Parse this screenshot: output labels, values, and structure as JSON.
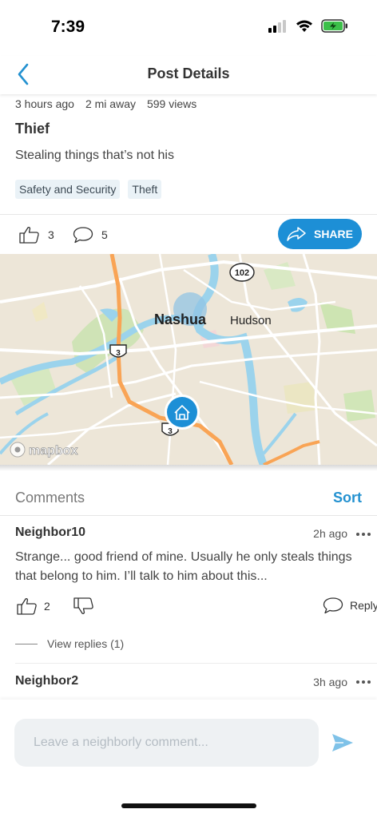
{
  "status_bar": {
    "time": "7:39",
    "icons": [
      "signal-icon",
      "wifi-icon",
      "battery-charging-icon"
    ],
    "battery_color": "#3cc04a"
  },
  "nav": {
    "title": "Post Details",
    "back_icon": "chevron-left-icon",
    "accent_color": "#2391d0"
  },
  "post": {
    "posted_ago": "3 hours ago",
    "distance": "2 mi away",
    "views": "599 views",
    "title": "Thief",
    "body": "Stealing things that’s not his",
    "tags": [
      "Safety and Security",
      "Theft"
    ],
    "likes": "3",
    "comments_count": "5",
    "share_label": "SHARE"
  },
  "map": {
    "city_primary": "Nashua",
    "city_secondary": "Hudson",
    "route_shields": [
      "102",
      "3",
      "3"
    ],
    "attribution": "mapbox",
    "marker_icon": "home-icon"
  },
  "comments": {
    "title": "Comments",
    "sort_label": "Sort",
    "items": [
      {
        "author": "Neighbor10",
        "time": "2h ago",
        "text": "Strange... good friend of mine. Usually he only steals things that belong to him. I’ll talk to him about this...",
        "likes": "2",
        "reply_label": "Reply",
        "view_replies": "View replies (1)"
      },
      {
        "author": "Neighbor2",
        "time": "3h ago"
      }
    ]
  },
  "composer": {
    "placeholder": "Leave a neighborly comment...",
    "value": "",
    "send_icon": "send-icon",
    "send_color": "#7fc2e8"
  }
}
